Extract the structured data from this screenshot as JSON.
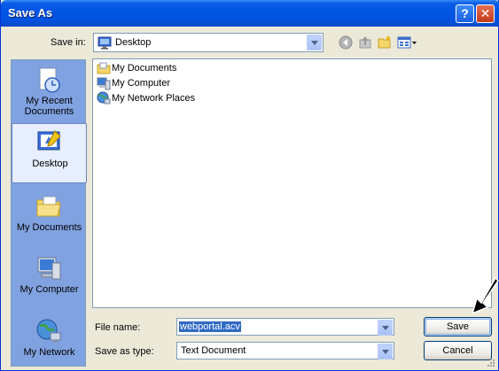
{
  "window": {
    "title": "Save As",
    "help_label": "?",
    "close_label": "✕"
  },
  "toolbar": {
    "save_in_label": "Save in:",
    "location_value": "Desktop",
    "location_icon": "desktop-icon",
    "back_icon": "back-arrow-icon",
    "up_icon": "up-folder-icon",
    "new_folder_icon": "new-folder-icon",
    "views_icon": "views-menu-icon"
  },
  "places": [
    {
      "label": "My Recent Documents",
      "icon": "recent-documents-icon",
      "selected": false
    },
    {
      "label": "Desktop",
      "icon": "desktop-icon",
      "selected": true
    },
    {
      "label": "My Documents",
      "icon": "my-documents-icon",
      "selected": false
    },
    {
      "label": "My Computer",
      "icon": "my-computer-icon",
      "selected": false
    },
    {
      "label": "My Network",
      "icon": "my-network-icon",
      "selected": false
    }
  ],
  "files": [
    {
      "label": "My Documents",
      "icon": "my-documents-icon"
    },
    {
      "label": "My Computer",
      "icon": "my-computer-icon"
    },
    {
      "label": "My Network Places",
      "icon": "network-places-icon"
    }
  ],
  "form": {
    "file_name_label": "File name:",
    "file_name_value": "webportal.acv",
    "save_as_type_label": "Save as type:",
    "save_as_type_value": "Text Document"
  },
  "buttons": {
    "save_label": "Save",
    "cancel_label": "Cancel"
  },
  "colors": {
    "titlebar": "#0054e3",
    "places_bar": "#80a2e0",
    "selection": "#316ac5",
    "window_bg": "#ece9d8"
  }
}
